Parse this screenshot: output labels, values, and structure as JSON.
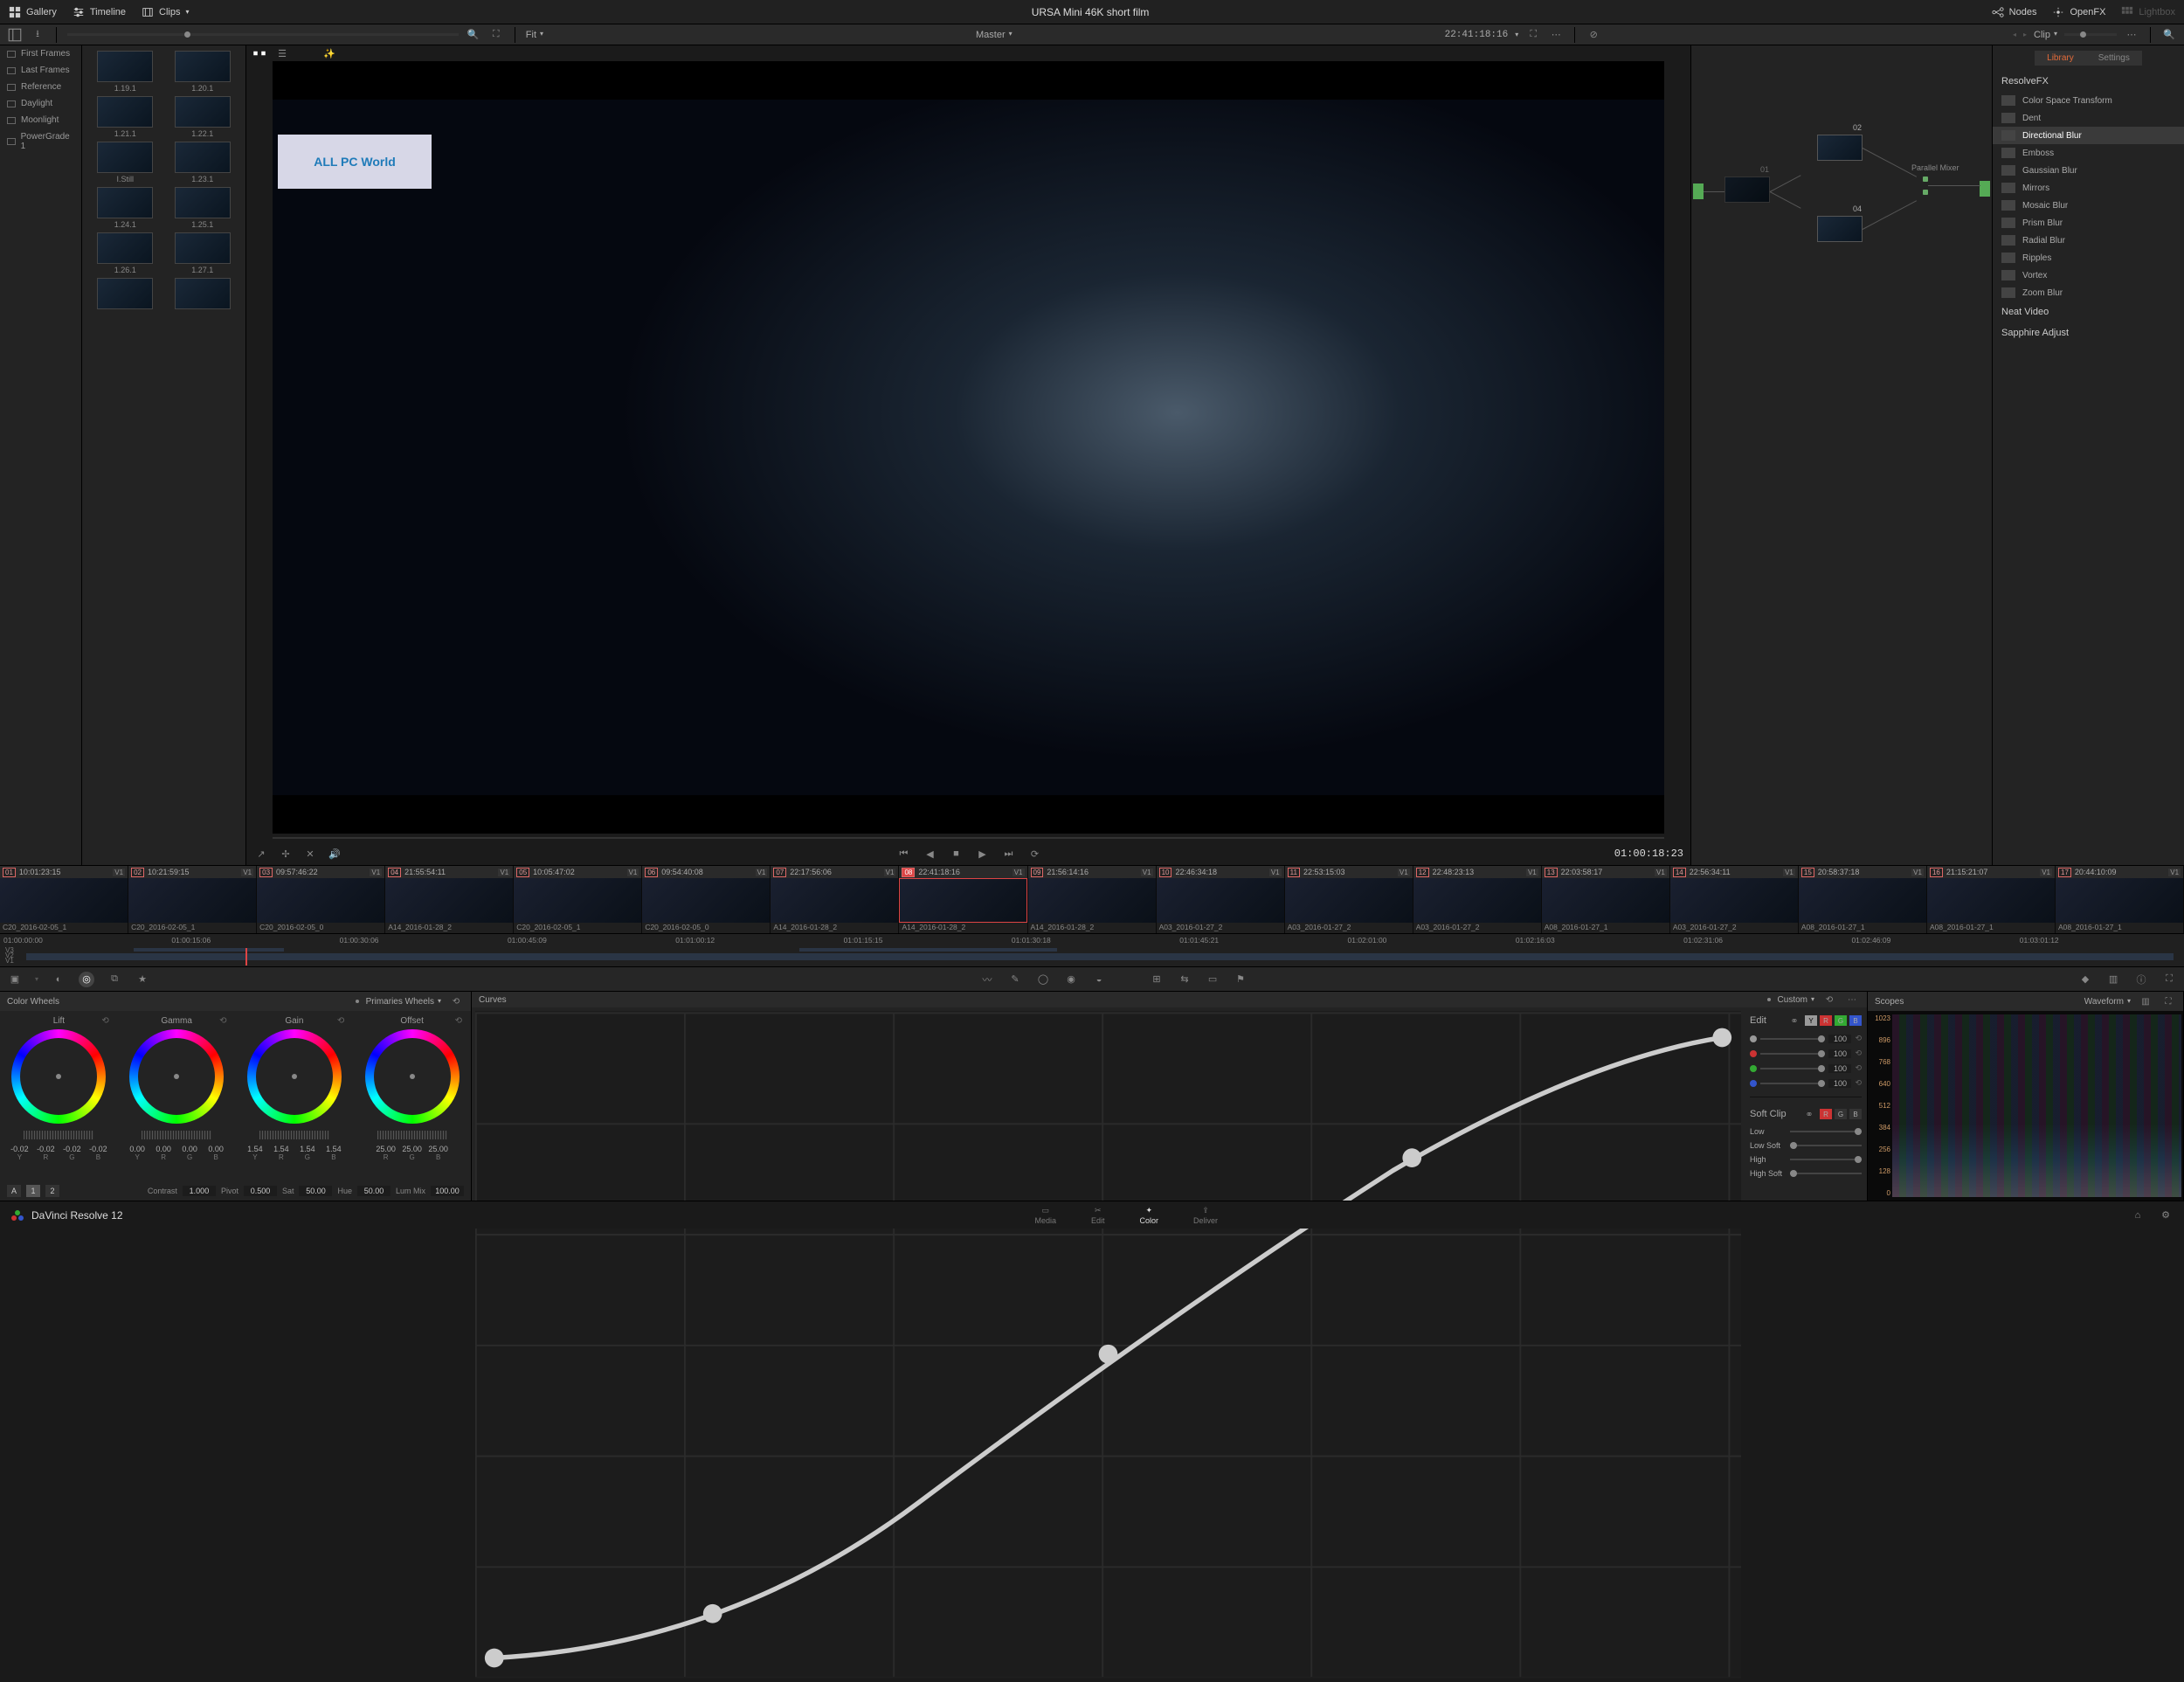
{
  "project_title": "URSA Mini 46K short film",
  "topbar": {
    "gallery": "Gallery",
    "timeline": "Timeline",
    "clips": "Clips",
    "nodes": "Nodes",
    "openfx": "OpenFX",
    "lightbox": "Lightbox"
  },
  "secondbar": {
    "fit": "Fit",
    "master": "Master",
    "viewer_tc": "22:41:18:16",
    "clip_label": "Clip",
    "search_placeholder": ""
  },
  "gallery_albums": [
    "First Frames",
    "Last Frames",
    "Reference",
    "Daylight",
    "Moonlight",
    "PowerGrade 1"
  ],
  "stills": [
    "1.19.1",
    "1.20.1",
    "1.21.1",
    "1.22.1",
    "I.Still",
    "1.23.1",
    "1.24.1",
    "1.25.1",
    "1.26.1",
    "1.27.1",
    "",
    ""
  ],
  "transport_tc": "01:00:18:23",
  "node_labels": {
    "n01": "01",
    "n02": "02",
    "n04": "04",
    "mixer": "Parallel Mixer"
  },
  "fx": {
    "tab_library": "Library",
    "tab_settings": "Settings",
    "group_resolvefx": "ResolveFX",
    "items": [
      "Color Space Transform",
      "Dent",
      "Directional Blur",
      "Emboss",
      "Gaussian Blur",
      "Mirrors",
      "Mosaic Blur",
      "Prism Blur",
      "Radial Blur",
      "Ripples",
      "Vortex",
      "Zoom Blur"
    ],
    "selected": "Directional Blur",
    "group_neat": "Neat Video",
    "group_sapphire": "Sapphire Adjust"
  },
  "clips": [
    {
      "n": "01",
      "tc": "10:01:23:15",
      "nm": "C20_2016-02-05_1"
    },
    {
      "n": "02",
      "tc": "10:21:59:15",
      "nm": "C20_2016-02-05_1"
    },
    {
      "n": "03",
      "tc": "09:57:46:22",
      "nm": "C20_2016-02-05_0"
    },
    {
      "n": "04",
      "tc": "21:55:54:11",
      "nm": "A14_2016-01-28_2"
    },
    {
      "n": "05",
      "tc": "10:05:47:02",
      "nm": "C20_2016-02-05_1"
    },
    {
      "n": "06",
      "tc": "09:54:40:08",
      "nm": "C20_2016-02-05_0"
    },
    {
      "n": "07",
      "tc": "22:17:56:06",
      "nm": "A14_2016-01-28_2"
    },
    {
      "n": "08",
      "tc": "22:41:18:16",
      "nm": "A14_2016-01-28_2"
    },
    {
      "n": "09",
      "tc": "21:56:14:16",
      "nm": "A14_2016-01-28_2"
    },
    {
      "n": "10",
      "tc": "22:46:34:18",
      "nm": "A03_2016-01-27_2"
    },
    {
      "n": "11",
      "tc": "22:53:15:03",
      "nm": "A03_2016-01-27_2"
    },
    {
      "n": "12",
      "tc": "22:48:23:13",
      "nm": "A03_2016-01-27_2"
    },
    {
      "n": "13",
      "tc": "22:03:58:17",
      "nm": "A08_2016-01-27_1"
    },
    {
      "n": "14",
      "tc": "22:56:34:11",
      "nm": "A03_2016-01-27_2"
    },
    {
      "n": "15",
      "tc": "20:58:37:18",
      "nm": "A08_2016-01-27_1"
    },
    {
      "n": "16",
      "tc": "21:15:21:07",
      "nm": "A08_2016-01-27_1"
    },
    {
      "n": "17",
      "tc": "20:44:10:09",
      "nm": "A08_2016-01-27_1"
    }
  ],
  "active_clip": "08",
  "ruler": [
    "01:00:00:00",
    "01:00:15:06",
    "01:00:30:06",
    "01:00:45:09",
    "01:01:00:12",
    "01:01:15:15",
    "01:01:30:18",
    "01:01:45:21",
    "01:02:01:00",
    "01:02:16:03",
    "01:02:31:06",
    "01:02:46:09",
    "01:03:01:12"
  ],
  "track_labels": [
    "V3",
    "V2",
    "V1"
  ],
  "wheels": {
    "header": "Color Wheels",
    "mode": "Primaries Wheels",
    "lift": {
      "title": "Lift",
      "vals": [
        "-0.02",
        "-0.02",
        "-0.02",
        "-0.02"
      ]
    },
    "gamma": {
      "title": "Gamma",
      "vals": [
        "0.00",
        "0.00",
        "0.00",
        "0.00"
      ]
    },
    "gain": {
      "title": "Gain",
      "vals": [
        "1.54",
        "1.54",
        "1.54",
        "1.54"
      ]
    },
    "offset": {
      "title": "Offset",
      "vals": [
        "25.00",
        "25.00",
        "25.00"
      ]
    },
    "channels": [
      "Y",
      "R",
      "G",
      "B"
    ],
    "channels3": [
      "R",
      "G",
      "B"
    ],
    "pages": [
      "A",
      "1",
      "2"
    ],
    "contrast_l": "Contrast",
    "contrast": "1.000",
    "pivot_l": "Pivot",
    "pivot": "0.500",
    "sat_l": "Sat",
    "sat": "50.00",
    "hue_l": "Hue",
    "hue": "50.00",
    "lummix_l": "Lum Mix",
    "lummix": "100.00"
  },
  "curves": {
    "header": "Curves",
    "mode": "Custom",
    "edit": "Edit",
    "softclip": "Soft Clip",
    "low": "Low",
    "lowsoft": "Low Soft",
    "high": "High",
    "highsoft": "High Soft",
    "hundred": "100"
  },
  "scopes": {
    "header": "Scopes",
    "mode": "Waveform",
    "levels": [
      "1023",
      "896",
      "768",
      "640",
      "512",
      "384",
      "256",
      "128",
      "0"
    ]
  },
  "pages": {
    "media": "Media",
    "edit": "Edit",
    "color": "Color",
    "deliver": "Deliver"
  },
  "brand": "DaVinci Resolve 12",
  "watermark_line1": "ALL PC World"
}
